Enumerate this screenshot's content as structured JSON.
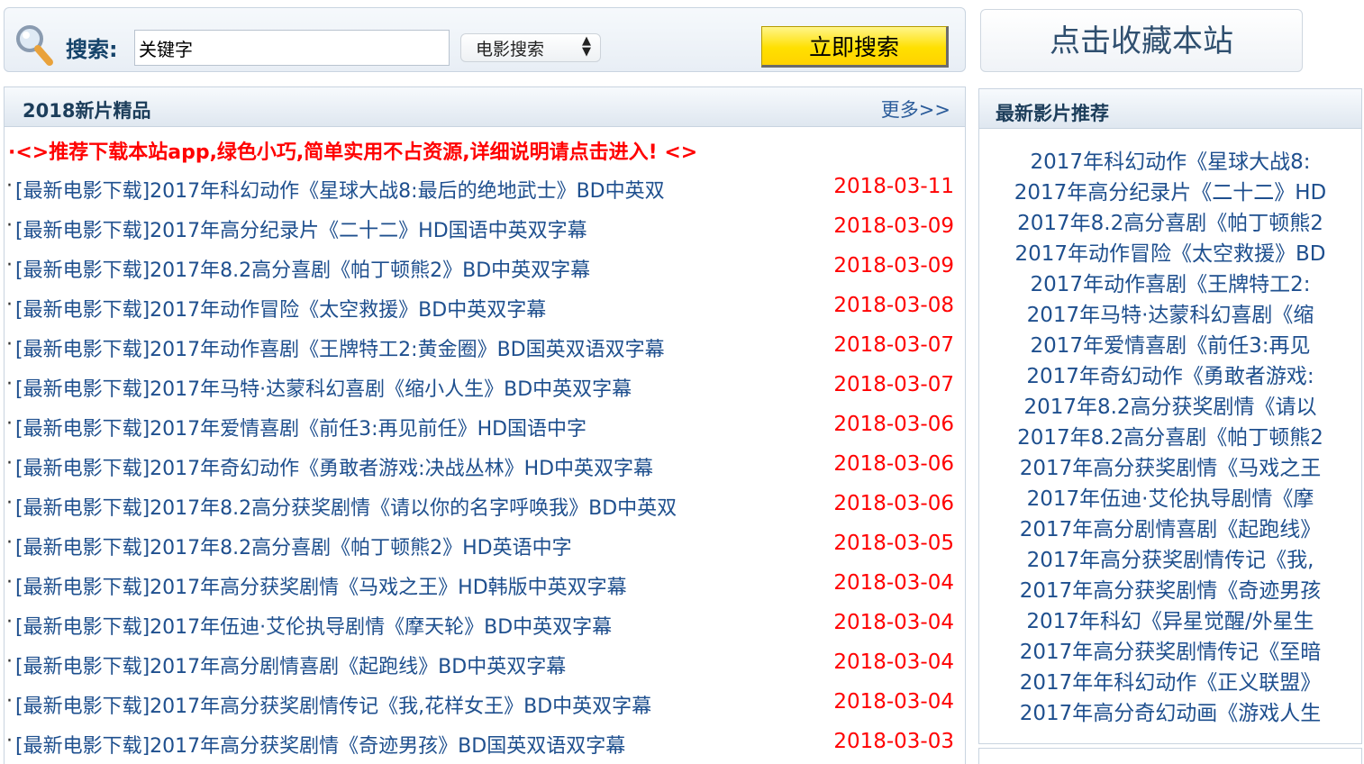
{
  "search": {
    "label": "搜索:",
    "input_value": "关键字",
    "select_value": "电影搜索",
    "button_label": "立即搜索"
  },
  "favorite": {
    "label": "点击收藏本站"
  },
  "main": {
    "title": "2018新片精品",
    "more": "更多>>",
    "promo": "·<>推荐下载本站app,绿色小巧,简单实用不占资源,详细说明请点击进入! <>",
    "items": [
      {
        "title": "[最新电影下载]2017年科幻动作《星球大战8:最后的绝地武士》BD中英双",
        "date": "2018-03-11"
      },
      {
        "title": "[最新电影下载]2017年高分纪录片《二十二》HD国语中英双字幕",
        "date": "2018-03-09"
      },
      {
        "title": "[最新电影下载]2017年8.2高分喜剧《帕丁顿熊2》BD中英双字幕",
        "date": "2018-03-09"
      },
      {
        "title": "[最新电影下载]2017年动作冒险《太空救援》BD中英双字幕",
        "date": "2018-03-08"
      },
      {
        "title": "[最新电影下载]2017年动作喜剧《王牌特工2:黄金圈》BD国英双语双字幕",
        "date": "2018-03-07"
      },
      {
        "title": "[最新电影下载]2017年马特·达蒙科幻喜剧《缩小人生》BD中英双字幕",
        "date": "2018-03-07"
      },
      {
        "title": "[最新电影下载]2017年爱情喜剧《前任3:再见前任》HD国语中字",
        "date": "2018-03-06"
      },
      {
        "title": "[最新电影下载]2017年奇幻动作《勇敢者游戏:决战丛林》HD中英双字幕",
        "date": "2018-03-06"
      },
      {
        "title": "[最新电影下载]2017年8.2高分获奖剧情《请以你的名字呼唤我》BD中英双",
        "date": "2018-03-06"
      },
      {
        "title": "[最新电影下载]2017年8.2高分喜剧《帕丁顿熊2》HD英语中字",
        "date": "2018-03-05"
      },
      {
        "title": "[最新电影下载]2017年高分获奖剧情《马戏之王》HD韩版中英双字幕",
        "date": "2018-03-04"
      },
      {
        "title": "[最新电影下载]2017年伍迪·艾伦执导剧情《摩天轮》BD中英双字幕",
        "date": "2018-03-04"
      },
      {
        "title": "[最新电影下载]2017年高分剧情喜剧《起跑线》BD中英双字幕",
        "date": "2018-03-04"
      },
      {
        "title": "[最新电影下载]2017年高分获奖剧情传记《我,花样女王》BD中英双字幕",
        "date": "2018-03-04"
      },
      {
        "title": "[最新电影下载]2017年高分获奖剧情《奇迹男孩》BD国英双语双字幕",
        "date": "2018-03-03"
      }
    ]
  },
  "side": {
    "title": "最新影片推荐",
    "items": [
      "2017年科幻动作《星球大战8:",
      "2017年高分纪录片《二十二》HD",
      "2017年8.2高分喜剧《帕丁顿熊2",
      "2017年动作冒险《太空救援》BD",
      "2017年动作喜剧《王牌特工2:",
      "2017年马特·达蒙科幻喜剧《缩",
      "2017年爱情喜剧《前任3:再见",
      "2017年奇幻动作《勇敢者游戏:",
      "2017年8.2高分获奖剧情《请以",
      "2017年8.2高分喜剧《帕丁顿熊2",
      "2017年高分获奖剧情《马戏之王",
      "2017年伍迪·艾伦执导剧情《摩",
      "2017年高分剧情喜剧《起跑线》",
      "2017年高分获奖剧情传记《我,",
      "2017年高分获奖剧情《奇迹男孩",
      "2017年科幻《异星觉醒/外星生",
      "2017年高分获奖剧情传记《至暗",
      "2017年年科幻动作《正义联盟》",
      "2017年高分奇幻动画《游戏人生"
    ]
  },
  "colors": {
    "link": "#1e4f8e",
    "date": "#ff0000",
    "promo": "#ff0000",
    "button": "#ffe000"
  }
}
